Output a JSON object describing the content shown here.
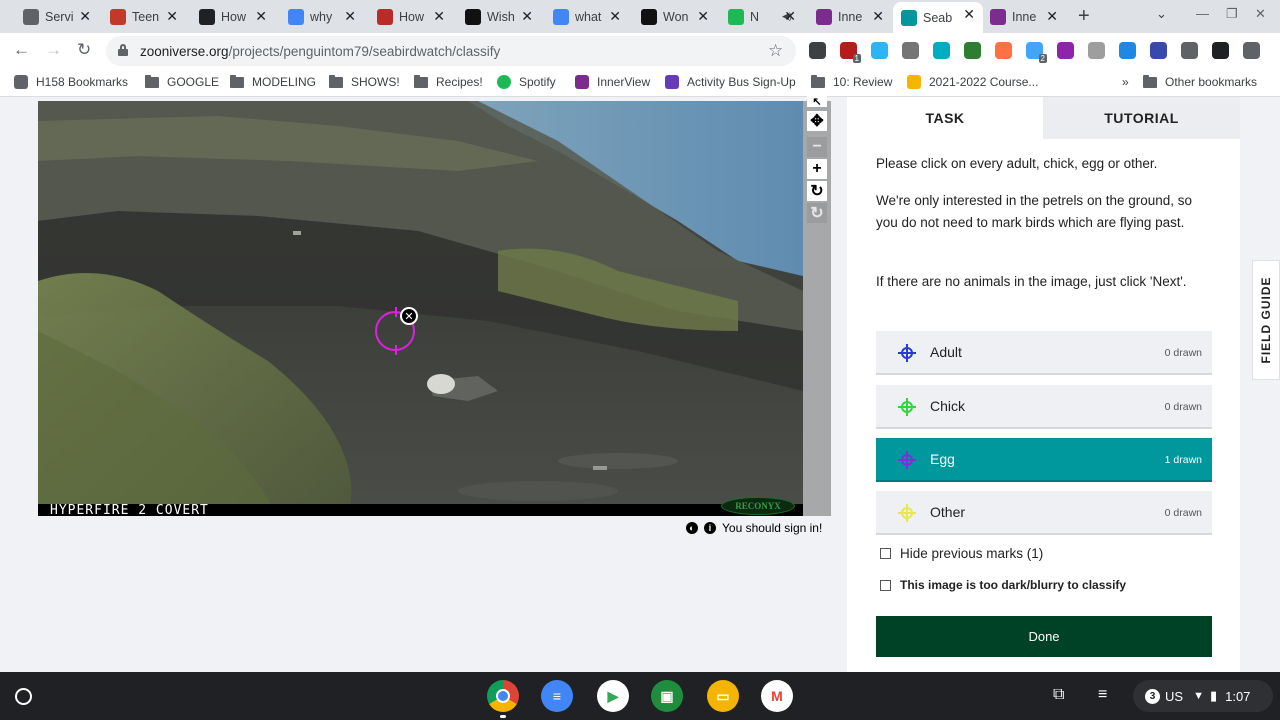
{
  "browser": {
    "tabs": [
      {
        "label": "Servi",
        "icon": "globe-icon",
        "color": "#5f6368"
      },
      {
        "label": "Teen",
        "icon": "news-icon",
        "color": "#c0392b"
      },
      {
        "label": "How",
        "icon": "tilde-icon",
        "color": "#202124"
      },
      {
        "label": "why",
        "icon": "google-icon",
        "color": "#4285f4"
      },
      {
        "label": "How",
        "icon": "quora-icon",
        "color": "#b92b27"
      },
      {
        "label": "Wish",
        "icon": "s-icon",
        "color": "#111111"
      },
      {
        "label": "what",
        "icon": "google-icon",
        "color": "#4285f4"
      },
      {
        "label": "Won",
        "icon": "dsw-icon",
        "color": "#111111"
      },
      {
        "label": "N",
        "icon": "spotify-icon",
        "color": "#1db954",
        "muted": "◀)"
      },
      {
        "label": "Inne",
        "icon": "innerview-icon",
        "color": "#7b2d8e"
      },
      {
        "label": "Seab",
        "icon": "zooniverse-icon",
        "color": "#00979d",
        "active": true
      },
      {
        "label": "Inne",
        "icon": "innerview-icon",
        "color": "#7b2d8e"
      }
    ],
    "url_domain": "zooniverse.org",
    "url_path": "/projects/penguintom79/seabirdwatch/classify",
    "new_tab": "+",
    "tab_chevron": "⌄",
    "window": {
      "minimize": "—",
      "restore": "❐",
      "close": "✕"
    },
    "nav": {
      "back": "←",
      "forward": "→",
      "reload": "↻",
      "star": "☆"
    },
    "extensions": [
      {
        "icon": "ext-icon-1",
        "color": "#3c4043",
        "badge": ""
      },
      {
        "icon": "ext-icon-2",
        "color": "#b71c1c",
        "badge": "1"
      },
      {
        "icon": "ext-icon-3",
        "color": "#29b6f6",
        "badge": ""
      },
      {
        "icon": "ext-icon-4",
        "color": "#757575",
        "badge": ""
      },
      {
        "icon": "ext-icon-5",
        "color": "#00acc1",
        "badge": ""
      },
      {
        "icon": "ext-icon-6",
        "color": "#2e7d32",
        "badge": ""
      },
      {
        "icon": "ext-icon-7",
        "color": "#ff7043",
        "badge": ""
      },
      {
        "icon": "ext-icon-8",
        "color": "#42a5f5",
        "badge": "2"
      },
      {
        "icon": "ext-icon-9",
        "color": "#8e24aa",
        "badge": ""
      },
      {
        "icon": "ext-icon-10",
        "color": "#9e9e9e",
        "badge": ""
      },
      {
        "icon": "ext-icon-11",
        "color": "#1e88e5",
        "badge": ""
      },
      {
        "icon": "ext-icon-12",
        "color": "#3949ab",
        "badge": ""
      },
      {
        "icon": "puzzle-icon",
        "color": "#5f6368",
        "badge": ""
      },
      {
        "icon": "sidepanel-icon",
        "color": "#202124",
        "badge": ""
      },
      {
        "icon": "menu-icon",
        "color": "#5f6368",
        "badge": ""
      }
    ],
    "bookmarks": [
      {
        "label": "H158 Bookmarks",
        "icon": "bookmark-folder-icon"
      },
      {
        "label": "GOOGLE",
        "icon": "folder-icon"
      },
      {
        "label": "MODELING",
        "icon": "folder-icon"
      },
      {
        "label": "SHOWS!",
        "icon": "folder-icon"
      },
      {
        "label": "Recipes!",
        "icon": "folder-icon"
      },
      {
        "label": "Spotify",
        "icon": "spotify-icon"
      },
      {
        "label": "InnerView",
        "icon": "innerview-icon"
      },
      {
        "label": "Activity Bus Sign-Up",
        "icon": "forms-icon"
      },
      {
        "label": "10: Review",
        "icon": "folder-icon"
      },
      {
        "label": "2021-2022 Course...",
        "icon": "drive-icon"
      }
    ],
    "more_bookmarks": "»",
    "other_bookmarks": "Other bookmarks"
  },
  "subject": {
    "camera_label": "HYPERFIRE 2 COVERT",
    "brand_label": "RECONYX",
    "mark_delete": "✕",
    "sign_in": "You should sign in!",
    "info_glyph": "i"
  },
  "viewer_tools": [
    "↖",
    "✥",
    "−",
    "+",
    "↻",
    "↻"
  ],
  "task": {
    "tabs": {
      "task": "TASK",
      "tutorial": "TUTORIAL"
    },
    "instructions": [
      "Please click on every adult, chick, egg or other.",
      "We're only interested in the petrels on the ground, so you do not need to mark birds which are flying past.",
      "If there are no animals in the image, just click 'Next'."
    ],
    "tools": [
      {
        "name": "Adult",
        "count": "0 drawn",
        "color": "#2a3ad6",
        "active": false
      },
      {
        "name": "Chick",
        "count": "0 drawn",
        "color": "#2fd63a",
        "active": false
      },
      {
        "name": "Egg",
        "count": "1 drawn",
        "color": "#7e2fe0",
        "active": true
      },
      {
        "name": "Other",
        "count": "0 drawn",
        "color": "#e8e84a",
        "active": false
      }
    ],
    "hide_marks": "Hide previous marks (1)",
    "too_dark": "This image is too dark/blurry to classify",
    "done": "Done",
    "field_guide": "FIELD GUIDE"
  },
  "shelf": {
    "apps": [
      {
        "name": "chrome-icon",
        "color": "#db4437",
        "glyph": ""
      },
      {
        "name": "docs-icon",
        "color": "#4285f4",
        "glyph": "≡"
      },
      {
        "name": "play-store-icon",
        "color": "#ffffff",
        "glyph": "▶"
      },
      {
        "name": "classroom-icon",
        "color": "#1e8e3e",
        "glyph": "▣"
      },
      {
        "name": "slides-icon",
        "color": "#f4b400",
        "glyph": "▭"
      },
      {
        "name": "gmail-icon",
        "color": "#ffffff",
        "glyph": "M"
      }
    ],
    "notification_count": "3",
    "locale": "US",
    "time": "1:07",
    "screen_capture_glyph": "⧉",
    "clipboard_glyph": "≡",
    "wifi_glyph": "▼",
    "battery_glyph": "▮"
  }
}
